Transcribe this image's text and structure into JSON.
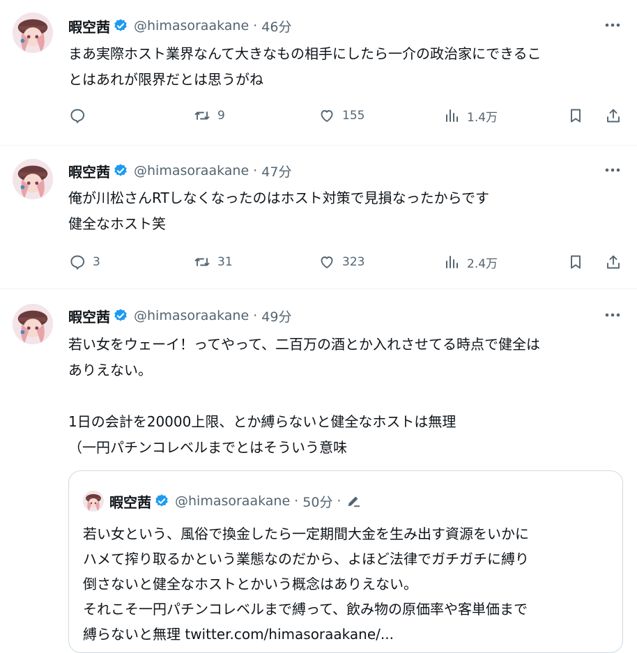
{
  "tweets": [
    {
      "name": "暇空茜",
      "handle": "@himasoraakane",
      "time": "46分",
      "text": "まあ実際ホスト業界なんて大きなもの相手にしたら一介の政治家にできるこ\nとはあれが限界だとは思うがね",
      "replies": "",
      "retweets": "9",
      "likes": "155",
      "views": "1.4万"
    },
    {
      "name": "暇空茜",
      "handle": "@himasoraakane",
      "time": "47分",
      "text": "俺が川松さんRTしなくなったのはホスト対策で見損なったからです\n健全なホスト笑",
      "replies": "3",
      "retweets": "31",
      "likes": "323",
      "views": "2.4万"
    },
    {
      "name": "暇空茜",
      "handle": "@himasoraakane",
      "time": "49分",
      "text": "若い女をウェーイ！ってやって、二百万の酒とか入れさせてる時点で健全は\nありえない。\n\n1日の会計を20000上限、とか縛らないと健全なホストは無理\n（一円パチンコレベルまでとはそういう意味"
    }
  ],
  "quote": {
    "name": "暇空茜",
    "handle": "@himasoraakane",
    "time": "50分",
    "text": "若い女という、風俗で換金したら一定期間大金を生み出す資源をいかに\nハメて搾り取るかという業態なのだから、よほど法律でガチガチに縛り\n倒さないと健全なホストとかいう概念はありえない。\nそれこそ一円パチンコレベルまで縛って、飲み物の原価率や客単価まで\n縛らないと無理 twitter.com/himasoraakane/..."
  },
  "colors": {
    "text": "#0f1419",
    "secondary": "#536471",
    "verified": "#1d9bf0",
    "border": "#eff3f4"
  },
  "icons": [
    "reply-icon",
    "retweet-icon",
    "like-icon",
    "views-icon",
    "bookmark-icon",
    "share-icon",
    "more-icon",
    "verified-badge-icon",
    "edit-icon"
  ]
}
